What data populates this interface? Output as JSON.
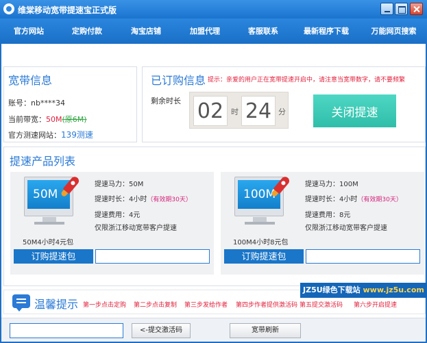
{
  "window": {
    "title": "维棠移动宽带提速宝正式版"
  },
  "nav": [
    "官方网站",
    "定购付款",
    "淘宝店铺",
    "加盟代理",
    "客服联系",
    "最新程序下载",
    "万能网页搜索"
  ],
  "broadband": {
    "title": "宽带信息",
    "account_label": "账号：",
    "account": "nb****34",
    "bandwidth_label": "当前带宽：",
    "bandwidth": "50M",
    "bandwidth_old": "(原6M)",
    "testsite_label": "官方测速网站：",
    "testsite": "139测速"
  },
  "subscribed": {
    "title": "已订购信息",
    "tip": "提示：亲爱的用户正在宽带提速开启中，请注意当宽带数字，请不要频繁",
    "remaining_label": "剩余时长",
    "hours": "02",
    "hour_unit": "时",
    "minutes": "24",
    "minute_unit": "分",
    "close_button": "关闭提速"
  },
  "products": {
    "title": "提速产品列表",
    "items": [
      {
        "screen": "50M",
        "package": "50M4小时4元包",
        "power": "提速马力：50M",
        "duration": "提速时长：4小时",
        "validity": "（有效期30天）",
        "fee": "提速费用：4元",
        "note": "仅限浙江移动宽带客户提速",
        "buy": "订购提速包"
      },
      {
        "screen": "100M",
        "package": "100M4小时8元包",
        "power": "提速马力：100M",
        "duration": "提速时长：4小时",
        "validity": "（有效期30天）",
        "fee": "提速费用：8元",
        "note": "仅限浙江移动宽带客户提速",
        "buy": "订购提速包"
      }
    ]
  },
  "tips": {
    "title": "温馨提示",
    "steps": [
      "第一步点击定购",
      "第二步点击复制",
      "第三步发给作者",
      "第四步作者提供激活码",
      "第五提交激活码",
      "第六步开启提速"
    ]
  },
  "bottom": {
    "submit_button": "<-提交激活码",
    "refresh_button": "宽带刷新",
    "watermark_brand": "JZ5U绿色下载站",
    "watermark_site": "www.jz5u.com"
  },
  "colors": {
    "brand_blue": "#1a74cf",
    "accent_teal": "#2fbea9",
    "alert_red": "#e0213c"
  }
}
